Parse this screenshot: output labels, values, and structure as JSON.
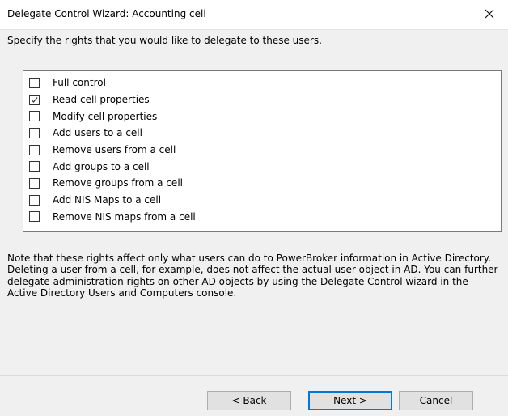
{
  "window": {
    "title": "Delegate Control Wizard: Accounting cell",
    "close_icon": "close-icon"
  },
  "instruction": "Specify the rights that you would like to delegate to these users.",
  "rights": [
    {
      "label": "Full control",
      "checked": false
    },
    {
      "label": "Read cell properties",
      "checked": true
    },
    {
      "label": "Modify cell properties",
      "checked": false
    },
    {
      "label": "Add users to a cell",
      "checked": false
    },
    {
      "label": "Remove users from a cell",
      "checked": false
    },
    {
      "label": "Add groups to a cell",
      "checked": false
    },
    {
      "label": "Remove groups from a cell",
      "checked": false
    },
    {
      "label": "Add NIS Maps to a cell",
      "checked": false
    },
    {
      "label": "Remove NIS maps from a cell",
      "checked": false
    }
  ],
  "note": "Note that these rights affect only what users can do to PowerBroker information in Active Directory. Deleting a user from a cell, for example, does not affect the actual user object in AD. You can further delegate administration rights on other AD objects by using the Delegate Control wizard in the Active Directory Users and Computers console.",
  "buttons": {
    "back": "< Back",
    "next": "Next >",
    "cancel": "Cancel"
  },
  "colors": {
    "dialog_background": "#f0f0f0",
    "default_button_border": "#0078d7"
  }
}
